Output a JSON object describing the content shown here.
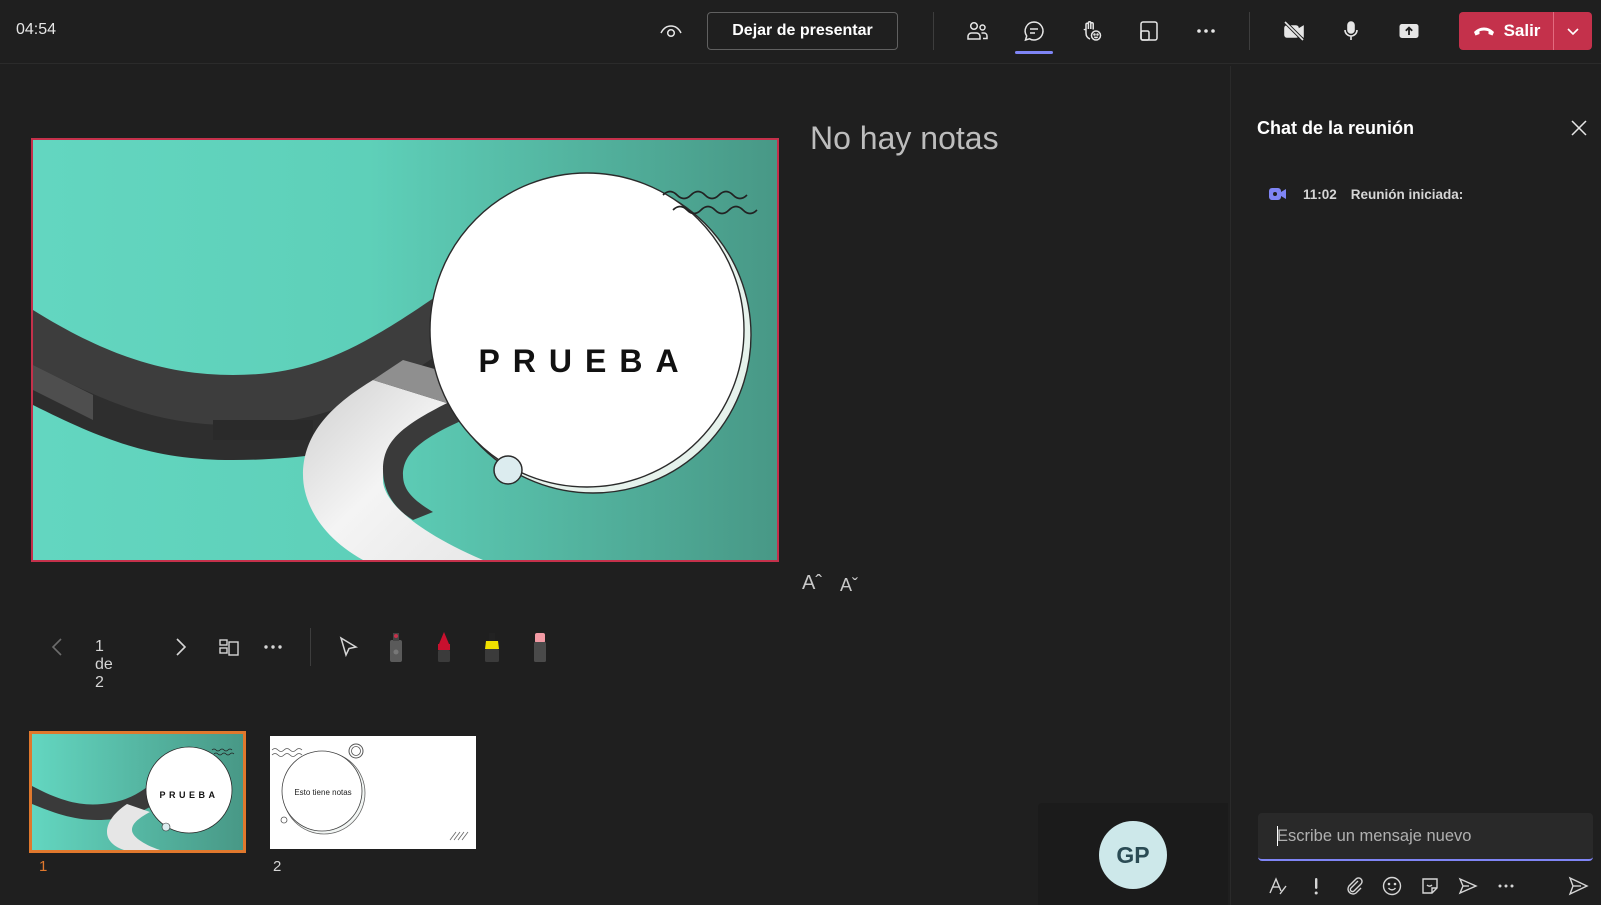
{
  "app": {
    "timer": "04:54"
  },
  "toolbar": {
    "stop_presenting_label": "Dejar de presentar",
    "leave_label": "Salir"
  },
  "presentation": {
    "slide_title": "PRUEBA",
    "notes_text": "No hay notas",
    "font_increase": "Aˆ",
    "font_decrease": "Aˇ",
    "page_counter": "1 de 2"
  },
  "thumbnails": [
    {
      "number": "1",
      "title": "PRUEBA",
      "selected": true
    },
    {
      "number": "2",
      "title": "Esto tiene notas",
      "selected": false
    }
  ],
  "participant": {
    "initials": "GP"
  },
  "chat": {
    "title": "Chat de la reunión",
    "event_time": "11:02",
    "event_text": "Reunión iniciada:",
    "compose_placeholder": "Escribe un mensaje nuevo"
  },
  "colors": {
    "accent": "#7f85f5",
    "leave": "#c4314b",
    "slide_teal": "#5ecfb8",
    "thumb_selected_border": "#e0782d"
  }
}
